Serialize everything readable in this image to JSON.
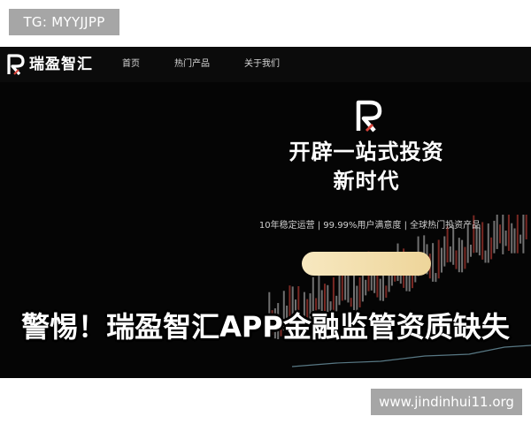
{
  "overlay": {
    "tg_label": "TG: MYYJJPP",
    "url_label": "www.jindinhui11.org"
  },
  "nav": {
    "brand": "瑞盈智汇",
    "items": [
      "首页",
      "热门产品",
      "关于我们"
    ],
    "logo_icon": "r-logo-icon"
  },
  "hero": {
    "title_line1": "开辟一站式投资",
    "title_line2": "新时代",
    "stats": "10年稳定运营 | 99.99%用户满意度 | 全球热门投资产品",
    "cta_color_start": "#f7e8c0",
    "cta_color_end": "#eed59a"
  },
  "headline": "警惕！瑞盈智汇APP金融监管资质缺失",
  "colors": {
    "background": "#050505",
    "candle_up": "#c9c9c9",
    "candle_down": "#d8453c",
    "line_accent": "#8fc4d8"
  }
}
